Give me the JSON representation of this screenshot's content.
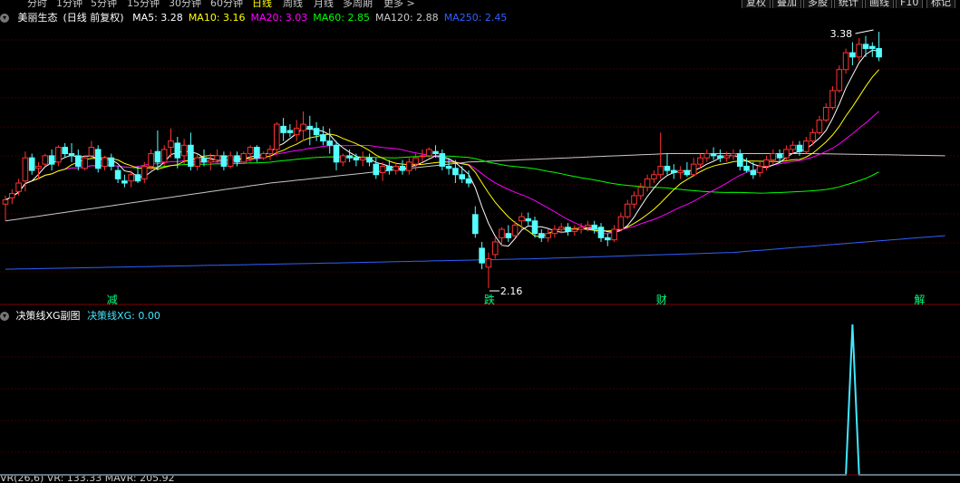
{
  "periods": [
    {
      "label": "分时",
      "color": "#c8c8c8"
    },
    {
      "label": "1分钟",
      "color": "#c8c8c8"
    },
    {
      "label": "5分钟",
      "color": "#c8c8c8"
    },
    {
      "label": "15分钟",
      "color": "#c8c8c8"
    },
    {
      "label": "30分钟",
      "color": "#c8c8c8"
    },
    {
      "label": "60分钟",
      "color": "#c8c8c8"
    },
    {
      "label": "日线",
      "color": "#ffff00"
    },
    {
      "label": "周线",
      "color": "#c8c8c8"
    },
    {
      "label": "月线",
      "color": "#c8c8c8"
    },
    {
      "label": "多周期",
      "color": "#c8c8c8"
    },
    {
      "label": "更多 >",
      "color": "#c8c8c8"
    }
  ],
  "toolbar": [
    "复权",
    "叠加",
    "多股",
    "统计",
    "画线",
    "F10",
    "标记"
  ],
  "stock": {
    "name": "美丽生态",
    "mode": "(日线 前复权)"
  },
  "ma_legend": [
    {
      "label": "MA5: 3.28",
      "color": "#ffffff"
    },
    {
      "label": "MA10: 3.16",
      "color": "#ffff00"
    },
    {
      "label": "MA20: 3.03",
      "color": "#ff00ff"
    },
    {
      "label": "MA60: 2.85",
      "color": "#00ff00"
    },
    {
      "label": "MA120: 2.88",
      "color": "#c8c8c8"
    },
    {
      "label": "MA250: 2.45",
      "color": "#3060ff"
    }
  ],
  "sub_legend": {
    "title": "决策线XG副图",
    "value_label": "决策线XG: 0.00",
    "value_color": "#40e8ff"
  },
  "bottom_legend": [
    {
      "label": "VR(26,6) VR: 133.33 MAVR: 205.92",
      "color": "#c8c8c8"
    }
  ],
  "price_labels": {
    "high": "3.38",
    "low": "2.16"
  },
  "markers": [
    {
      "label": "减",
      "candle": 16
    },
    {
      "label": "跌",
      "candle": 73
    },
    {
      "label": "财",
      "candle": 99
    },
    {
      "label": "解",
      "candle": 138
    }
  ],
  "colors": {
    "up": "#ff3232",
    "down": "#54ffff",
    "grid": "#3a0000",
    "ma5": "#ffffff",
    "ma10": "#ffff00",
    "ma20": "#ff00ff",
    "ma60": "#00ff00",
    "ma120": "#c8c8c8",
    "ma250": "#3060ff",
    "indicator": "#40e8ff",
    "marker": "#00ff80"
  },
  "chart_data": [
    {
      "type": "candlestick",
      "title": "美丽生态",
      "series_order": [
        "open",
        "high",
        "low",
        "close"
      ],
      "price_range": [
        2.16,
        3.38
      ],
      "candles": [
        [
          2.56,
          2.6,
          2.48,
          2.58
        ],
        [
          2.59,
          2.63,
          2.56,
          2.61
        ],
        [
          2.62,
          2.68,
          2.6,
          2.66
        ],
        [
          2.67,
          2.81,
          2.62,
          2.78
        ],
        [
          2.78,
          2.8,
          2.7,
          2.72
        ],
        [
          2.73,
          2.76,
          2.68,
          2.74
        ],
        [
          2.75,
          2.8,
          2.74,
          2.79
        ],
        [
          2.79,
          2.82,
          2.72,
          2.75
        ],
        [
          2.76,
          2.84,
          2.74,
          2.83
        ],
        [
          2.83,
          2.85,
          2.78,
          2.8
        ],
        [
          2.8,
          2.85,
          2.76,
          2.79
        ],
        [
          2.79,
          2.82,
          2.72,
          2.74
        ],
        [
          2.73,
          2.79,
          2.72,
          2.78
        ],
        [
          2.79,
          2.86,
          2.78,
          2.83
        ],
        [
          2.82,
          2.84,
          2.71,
          2.73
        ],
        [
          2.74,
          2.79,
          2.72,
          2.78
        ],
        [
          2.78,
          2.8,
          2.72,
          2.74
        ],
        [
          2.72,
          2.74,
          2.66,
          2.68
        ],
        [
          2.67,
          2.7,
          2.64,
          2.66
        ],
        [
          2.67,
          2.72,
          2.64,
          2.7
        ],
        [
          2.7,
          2.74,
          2.66,
          2.67
        ],
        [
          2.68,
          2.76,
          2.66,
          2.74
        ],
        [
          2.74,
          2.82,
          2.72,
          2.8
        ],
        [
          2.81,
          2.91,
          2.72,
          2.76
        ],
        [
          2.76,
          2.84,
          2.74,
          2.82
        ],
        [
          2.83,
          2.92,
          2.78,
          2.86
        ],
        [
          2.85,
          2.88,
          2.73,
          2.78
        ],
        [
          2.79,
          2.87,
          2.75,
          2.84
        ],
        [
          2.84,
          2.9,
          2.72,
          2.74
        ],
        [
          2.74,
          2.8,
          2.72,
          2.78
        ],
        [
          2.78,
          2.82,
          2.74,
          2.76
        ],
        [
          2.76,
          2.8,
          2.72,
          2.77
        ],
        [
          2.77,
          2.82,
          2.75,
          2.79
        ],
        [
          2.79,
          2.81,
          2.72,
          2.74
        ],
        [
          2.74,
          2.81,
          2.73,
          2.79
        ],
        [
          2.79,
          2.81,
          2.74,
          2.76
        ],
        [
          2.76,
          2.81,
          2.75,
          2.8
        ],
        [
          2.8,
          2.84,
          2.76,
          2.83
        ],
        [
          2.83,
          2.84,
          2.76,
          2.78
        ],
        [
          2.78,
          2.81,
          2.77,
          2.8
        ],
        [
          2.8,
          2.84,
          2.77,
          2.82
        ],
        [
          2.82,
          2.95,
          2.8,
          2.94
        ],
        [
          2.93,
          2.97,
          2.86,
          2.9
        ],
        [
          2.91,
          2.94,
          2.88,
          2.9
        ],
        [
          2.89,
          2.96,
          2.86,
          2.92
        ],
        [
          2.91,
          3.0,
          2.86,
          2.94
        ],
        [
          2.93,
          2.98,
          2.84,
          2.92
        ],
        [
          2.92,
          2.95,
          2.86,
          2.89
        ],
        [
          2.89,
          2.93,
          2.84,
          2.86
        ],
        [
          2.86,
          2.92,
          2.8,
          2.84
        ],
        [
          2.84,
          2.86,
          2.72,
          2.76
        ],
        [
          2.76,
          2.8,
          2.74,
          2.79
        ],
        [
          2.79,
          2.82,
          2.76,
          2.78
        ],
        [
          2.78,
          2.8,
          2.74,
          2.77
        ],
        [
          2.77,
          2.81,
          2.74,
          2.78
        ],
        [
          2.78,
          2.8,
          2.74,
          2.76
        ],
        [
          2.75,
          2.78,
          2.68,
          2.7
        ],
        [
          2.71,
          2.76,
          2.67,
          2.74
        ],
        [
          2.74,
          2.77,
          2.7,
          2.72
        ],
        [
          2.72,
          2.76,
          2.7,
          2.74
        ],
        [
          2.74,
          2.77,
          2.7,
          2.72
        ],
        [
          2.72,
          2.78,
          2.7,
          2.76
        ],
        [
          2.75,
          2.8,
          2.72,
          2.78
        ],
        [
          2.79,
          2.82,
          2.76,
          2.79
        ],
        [
          2.79,
          2.83,
          2.78,
          2.82
        ],
        [
          2.81,
          2.84,
          2.78,
          2.8
        ],
        [
          2.8,
          2.82,
          2.72,
          2.74
        ],
        [
          2.74,
          2.78,
          2.7,
          2.73
        ],
        [
          2.73,
          2.77,
          2.66,
          2.7
        ],
        [
          2.7,
          2.74,
          2.66,
          2.68
        ],
        [
          2.68,
          2.72,
          2.64,
          2.66
        ],
        [
          2.51,
          2.55,
          2.4,
          2.42
        ],
        [
          2.35,
          2.38,
          2.25,
          2.28
        ],
        [
          2.26,
          2.33,
          2.16,
          2.3
        ],
        [
          2.32,
          2.4,
          2.3,
          2.38
        ],
        [
          2.4,
          2.45,
          2.36,
          2.44
        ],
        [
          2.42,
          2.46,
          2.38,
          2.4
        ],
        [
          2.41,
          2.48,
          2.4,
          2.46
        ],
        [
          2.48,
          2.52,
          2.44,
          2.5
        ],
        [
          2.49,
          2.52,
          2.46,
          2.48
        ],
        [
          2.48,
          2.5,
          2.4,
          2.42
        ],
        [
          2.42,
          2.44,
          2.38,
          2.4
        ],
        [
          2.4,
          2.44,
          2.38,
          2.42
        ],
        [
          2.42,
          2.46,
          2.4,
          2.44
        ],
        [
          2.44,
          2.47,
          2.42,
          2.45
        ],
        [
          2.45,
          2.47,
          2.41,
          2.43
        ],
        [
          2.43,
          2.46,
          2.41,
          2.44
        ],
        [
          2.44,
          2.47,
          2.42,
          2.45
        ],
        [
          2.45,
          2.48,
          2.43,
          2.46
        ],
        [
          2.46,
          2.48,
          2.42,
          2.44
        ],
        [
          2.45,
          2.47,
          2.38,
          2.4
        ],
        [
          2.4,
          2.42,
          2.36,
          2.39
        ],
        [
          2.39,
          2.46,
          2.38,
          2.44
        ],
        [
          2.44,
          2.52,
          2.43,
          2.5
        ],
        [
          2.5,
          2.58,
          2.49,
          2.56
        ],
        [
          2.56,
          2.62,
          2.54,
          2.6
        ],
        [
          2.6,
          2.66,
          2.58,
          2.64
        ],
        [
          2.64,
          2.7,
          2.62,
          2.68
        ],
        [
          2.68,
          2.72,
          2.66,
          2.7
        ],
        [
          2.7,
          2.9,
          2.68,
          2.74
        ],
        [
          2.74,
          2.8,
          2.7,
          2.72
        ],
        [
          2.72,
          2.75,
          2.68,
          2.71
        ],
        [
          2.71,
          2.74,
          2.68,
          2.72
        ],
        [
          2.72,
          2.76,
          2.69,
          2.7
        ],
        [
          2.7,
          2.78,
          2.69,
          2.75
        ],
        [
          2.75,
          2.8,
          2.73,
          2.78
        ],
        [
          2.78,
          2.82,
          2.76,
          2.8
        ],
        [
          2.8,
          2.83,
          2.77,
          2.79
        ],
        [
          2.79,
          2.82,
          2.76,
          2.78
        ],
        [
          2.78,
          2.81,
          2.76,
          2.79
        ],
        [
          2.79,
          2.82,
          2.77,
          2.8
        ],
        [
          2.8,
          2.82,
          2.72,
          2.74
        ],
        [
          2.74,
          2.78,
          2.71,
          2.72
        ],
        [
          2.72,
          2.76,
          2.68,
          2.7
        ],
        [
          2.71,
          2.76,
          2.69,
          2.74
        ],
        [
          2.74,
          2.79,
          2.72,
          2.77
        ],
        [
          2.77,
          2.82,
          2.75,
          2.8
        ],
        [
          2.8,
          2.82,
          2.76,
          2.78
        ],
        [
          2.78,
          2.84,
          2.77,
          2.82
        ],
        [
          2.82,
          2.86,
          2.8,
          2.84
        ],
        [
          2.84,
          2.86,
          2.79,
          2.81
        ],
        [
          2.81,
          2.88,
          2.8,
          2.86
        ],
        [
          2.86,
          2.92,
          2.84,
          2.9
        ],
        [
          2.9,
          2.98,
          2.89,
          2.96
        ],
        [
          2.96,
          3.04,
          2.95,
          3.02
        ],
        [
          3.02,
          3.12,
          3.01,
          3.1
        ],
        [
          3.1,
          3.22,
          3.09,
          3.2
        ],
        [
          3.2,
          3.3,
          3.18,
          3.28
        ],
        [
          3.28,
          3.33,
          3.22,
          3.26
        ],
        [
          3.26,
          3.35,
          3.24,
          3.32
        ],
        [
          3.32,
          3.36,
          3.26,
          3.3
        ],
        [
          3.31,
          3.33,
          3.26,
          3.3
        ],
        [
          3.3,
          3.38,
          3.24,
          3.26
        ]
      ],
      "ma": {
        "ma5": "derived from candles (close, 5)",
        "ma10": "derived from candles (close, 10)",
        "ma20": "derived from candles (close, 20)",
        "ma60": "derived from candles (close, 60)"
      },
      "ma120_points": [
        [
          0,
          2.48
        ],
        [
          40,
          2.66
        ],
        [
          70,
          2.76
        ],
        [
          100,
          2.8
        ],
        [
          122,
          2.8
        ],
        [
          142,
          2.79
        ]
      ],
      "ma250_points": [
        [
          0,
          2.25
        ],
        [
          50,
          2.28
        ],
        [
          80,
          2.3
        ],
        [
          110,
          2.33
        ],
        [
          130,
          2.38
        ],
        [
          142,
          2.41
        ]
      ]
    },
    {
      "type": "line",
      "title": "决策线XG",
      "ylim": [
        0,
        1
      ],
      "x": "candle index",
      "values_note": "0 everywhere except a spike at candle 128",
      "values": [
        [
          0,
          0
        ],
        [
          126,
          0
        ],
        [
          127,
          0
        ],
        [
          128,
          1
        ],
        [
          129,
          0
        ],
        [
          142,
          0
        ]
      ]
    }
  ]
}
